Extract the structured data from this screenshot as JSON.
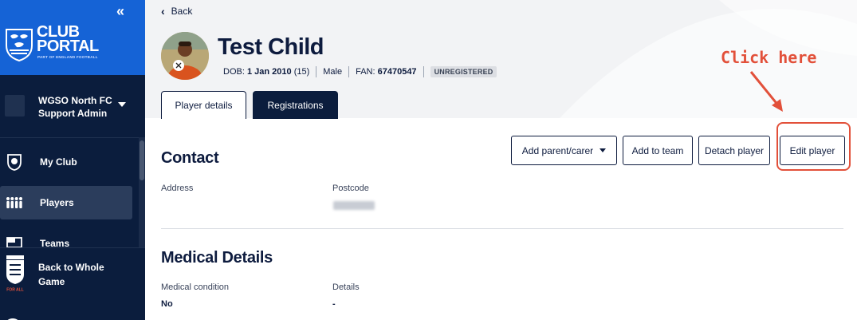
{
  "sidebar": {
    "collapse_icon": "«",
    "brand_line1": "CLUB",
    "brand_line2": "PORTAL",
    "brand_sub": "PART OF ENGLAND FOOTBALL",
    "club_name_line1": "WGSO North FC",
    "club_name_line2": "Support Admin",
    "nav": [
      {
        "label": "My Club",
        "icon": "shield-icon"
      },
      {
        "label": "Players",
        "icon": "players-icon",
        "active": true
      },
      {
        "label": "Teams",
        "icon": "teams-icon"
      }
    ],
    "back_line1": "Back to Whole",
    "back_line2": "Game",
    "fa_badge_text": "For All"
  },
  "header": {
    "back_label": "Back",
    "player_name": "Test Child",
    "dob_label": "DOB:",
    "dob_value": "1 Jan 2010",
    "age": "(15)",
    "gender": "Male",
    "fan_label": "FAN:",
    "fan_value": "67470547",
    "status_badge": "UNREGISTERED"
  },
  "annotation": {
    "text": "Click here",
    "color": "#e2503a"
  },
  "tabs": [
    {
      "label": "Player details",
      "active": true
    },
    {
      "label": "Registrations",
      "active": false
    }
  ],
  "contact": {
    "title": "Contact",
    "address_label": "Address",
    "postcode_label": "Postcode"
  },
  "actions": {
    "add_parent": "Add parent/carer",
    "add_team": "Add to team",
    "detach": "Detach player",
    "edit": "Edit player"
  },
  "medical": {
    "title": "Medical Details",
    "condition_label": "Medical condition",
    "condition_value": "No",
    "details_label": "Details",
    "details_value": "-"
  },
  "colors": {
    "brand_blue": "#1563d6",
    "navy": "#0b1d3d",
    "accent_red": "#e2503a"
  }
}
